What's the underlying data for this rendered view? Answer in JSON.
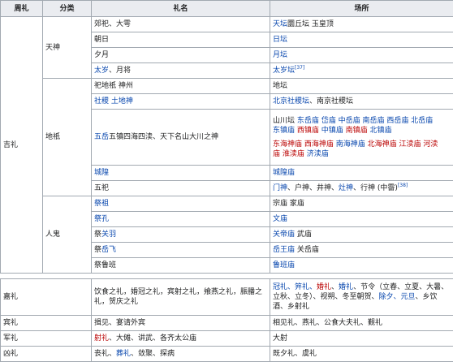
{
  "headers": [
    "周礼",
    "分类",
    "礼名",
    "场所"
  ],
  "jili": {
    "label": "吉礼",
    "tianshen": {
      "label": "天神",
      "rows": [
        {
          "name": [
            {
              "t": "郊祀、大雩",
              "c": "k"
            }
          ],
          "place": [
            {
              "t": "天坛",
              "c": "b"
            },
            {
              "t": "圜丘坛 玉皇顶",
              "c": "k"
            }
          ]
        },
        {
          "name": [
            {
              "t": "朝日",
              "c": "k"
            }
          ],
          "place": [
            {
              "t": "日坛",
              "c": "b"
            }
          ]
        },
        {
          "name": [
            {
              "t": "夕月",
              "c": "k"
            }
          ],
          "place": [
            {
              "t": "月坛",
              "c": "b"
            }
          ]
        },
        {
          "name": [
            {
              "t": "太岁",
              "c": "b"
            },
            {
              "t": "、月将",
              "c": "k"
            }
          ],
          "place": [
            {
              "t": "太岁坛",
              "c": "b"
            }
          ],
          "sup": "[37]"
        }
      ]
    },
    "diqi": {
      "label": "地祇",
      "rows": [
        {
          "name": [
            {
              "t": "祀地祇 神州",
              "c": "k"
            }
          ],
          "place": [
            {
              "t": "地坛",
              "c": "k"
            }
          ]
        },
        {
          "name": [
            {
              "t": "社稷 土地神",
              "c": "b"
            }
          ],
          "place": [
            {
              "t": "北京社稷坛",
              "c": "b"
            },
            {
              "t": "、南京社稷坛",
              "c": "k"
            }
          ]
        },
        {
          "name": [
            {
              "t": "五岳",
              "c": "b"
            },
            {
              "t": "五镇四海四渎、天下名山大川之神",
              "c": "k"
            }
          ],
          "place_lines": [
            [
              {
                "t": "山川坛 ",
                "c": "k"
              },
              {
                "t": "东岳庙 岱庙 中岳庙 南岳庙 西岳庙 北岳庙",
                "c": "b"
              }
            ],
            [
              {
                "t": "东镇庙 ",
                "c": "b"
              },
              {
                "t": "西镇庙 ",
                "c": "r"
              },
              {
                "t": "中镇庙 ",
                "c": "b"
              },
              {
                "t": "南镇庙 ",
                "c": "r"
              },
              {
                "t": "北镇庙",
                "c": "b"
              }
            ],
            [
              {
                "t": "",
                "c": "k"
              }
            ],
            [
              {
                "t": "东海神庙 西海神庙 ",
                "c": "r"
              },
              {
                "t": "南海神庙 ",
                "c": "b"
              },
              {
                "t": "北海神庙 江渎庙 河渎",
                "c": "r"
              }
            ],
            [
              {
                "t": "庙 淮渎庙 ",
                "c": "r"
              },
              {
                "t": "济渎庙",
                "c": "b"
              }
            ]
          ]
        },
        {
          "name": [
            {
              "t": "城隍",
              "c": "b"
            }
          ],
          "place": [
            {
              "t": "城隍庙",
              "c": "b"
            }
          ]
        },
        {
          "name": [
            {
              "t": "五祀",
              "c": "k"
            }
          ],
          "place": [
            {
              "t": "门神",
              "c": "b"
            },
            {
              "t": "、户神、井神、",
              "c": "k"
            },
            {
              "t": "灶神",
              "c": "b"
            },
            {
              "t": "、行神 (中霤)",
              "c": "k"
            }
          ],
          "sup": "[38]"
        }
      ]
    },
    "rengui": {
      "label": "人鬼",
      "rows": [
        {
          "name": [
            {
              "t": "祭祖",
              "c": "b"
            }
          ],
          "place": [
            {
              "t": "宗庙 家庙",
              "c": "k"
            }
          ]
        },
        {
          "name": [
            {
              "t": "祭孔",
              "c": "b"
            }
          ],
          "place": [
            {
              "t": "文庙",
              "c": "b"
            }
          ]
        },
        {
          "name": [
            {
              "t": "祭",
              "c": "k"
            },
            {
              "t": "关羽",
              "c": "b"
            }
          ],
          "place": [
            {
              "t": "关帝庙",
              "c": "b"
            },
            {
              "t": " 武庙",
              "c": "k"
            }
          ]
        },
        {
          "name": [
            {
              "t": "祭",
              "c": "k"
            },
            {
              "t": "岳飞",
              "c": "b"
            }
          ],
          "place": [
            {
              "t": "岳王庙",
              "c": "b"
            },
            {
              "t": " 关岳庙",
              "c": "k"
            }
          ]
        },
        {
          "name": [
            {
              "t": "祭鲁班",
              "c": "k"
            }
          ],
          "place": [
            {
              "t": "鲁班庙",
              "c": "b"
            }
          ]
        }
      ]
    }
  },
  "jiali": {
    "label": "嘉礼",
    "name": [
      {
        "t": "饮食之礼，婚冠之礼，宾射之礼，飨燕之礼，脤膰之礼，贺庆之礼",
        "c": "k"
      }
    ],
    "place_lines": [
      [
        {
          "t": "冠礼、笄礼、",
          "c": "b"
        },
        {
          "t": "婚礼",
          "c": "r"
        },
        {
          "t": "、",
          "c": "k"
        },
        {
          "t": "婚礼",
          "c": "b"
        },
        {
          "t": "、节令（立春、立夏、大暑、",
          "c": "k"
        }
      ],
      [
        {
          "t": "立秋、立冬）、视朔、冬至朝贺、",
          "c": "k"
        },
        {
          "t": "除夕、元旦",
          "c": "b"
        },
        {
          "t": "、乡饮",
          "c": "k"
        }
      ],
      [
        {
          "t": "酒、乡射礼",
          "c": "k"
        }
      ]
    ]
  },
  "binli": {
    "label": "宾礼",
    "name": [
      {
        "t": "揖见、宴请外宾",
        "c": "k"
      }
    ],
    "place": [
      {
        "t": "相见礼、燕礼、公食大夫礼、觐礼",
        "c": "k"
      }
    ]
  },
  "junli": {
    "label": "军礼",
    "name": [
      {
        "t": "射礼",
        "c": "r"
      },
      {
        "t": "、大傩、讲武、各齐太公庙",
        "c": "k"
      }
    ],
    "place": [
      {
        "t": "大射",
        "c": "k"
      }
    ]
  },
  "xiongli": {
    "label": "凶礼",
    "name": [
      {
        "t": "丧礼、",
        "c": "k"
      },
      {
        "t": "葬礼",
        "c": "b"
      },
      {
        "t": "、敛聚、探病",
        "c": "k"
      }
    ],
    "place": [
      {
        "t": "既夕礼、虞礼",
        "c": "k"
      }
    ]
  }
}
